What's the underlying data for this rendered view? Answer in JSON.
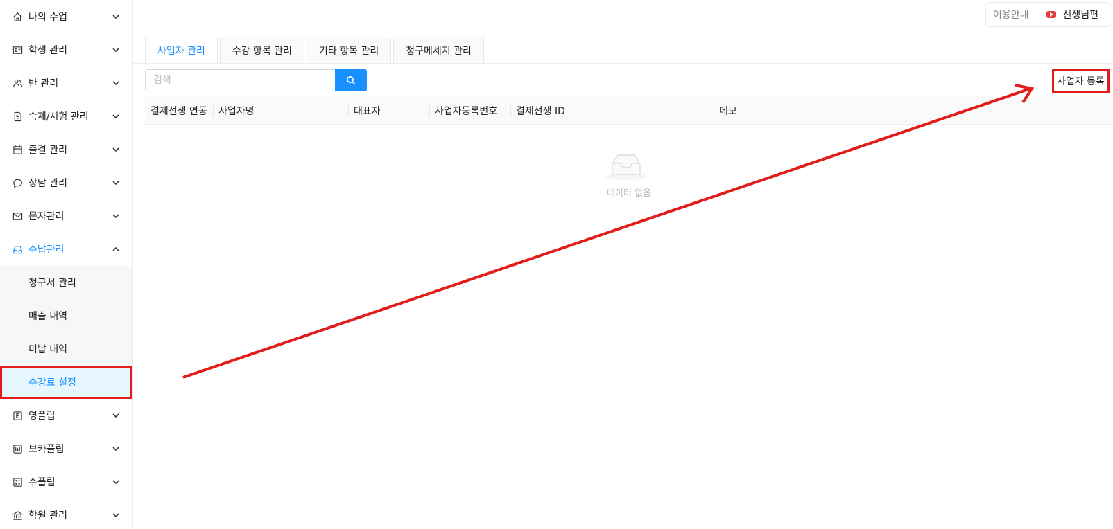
{
  "sidebar": {
    "items": [
      {
        "label": "나의 수업",
        "icon": "home-icon"
      },
      {
        "label": "학생 관리",
        "icon": "id-card-icon"
      },
      {
        "label": "반 관리",
        "icon": "users-icon"
      },
      {
        "label": "숙제/시험 관리",
        "icon": "document-icon"
      },
      {
        "label": "출결 관리",
        "icon": "calendar-icon"
      },
      {
        "label": "상담 관리",
        "icon": "chat-icon"
      },
      {
        "label": "문자관리",
        "icon": "mail-icon"
      },
      {
        "label": "수납관리",
        "icon": "inbox-icon"
      }
    ],
    "submenu": [
      {
        "label": "청구서 관리"
      },
      {
        "label": "매출 내역"
      },
      {
        "label": "미납 내역"
      },
      {
        "label": "수강료 설정"
      }
    ],
    "items_after": [
      {
        "label": "영플립",
        "icon": "letter-e-icon"
      },
      {
        "label": "보카플립",
        "icon": "letter-w-icon"
      },
      {
        "label": "수플립",
        "icon": "calculator-icon"
      },
      {
        "label": "학원 관리",
        "icon": "bank-icon"
      }
    ]
  },
  "header": {
    "help_label": "이용안내",
    "teacher_label": "선생님편"
  },
  "tabs": [
    {
      "label": "사업자 관리"
    },
    {
      "label": "수강 항목 관리"
    },
    {
      "label": "기타 항목 관리"
    },
    {
      "label": "청구메세지 관리"
    }
  ],
  "search": {
    "placeholder": "검색"
  },
  "toolbar": {
    "register_label": "사업자 등록"
  },
  "table": {
    "columns": [
      "결제선생 연동",
      "사업자명",
      "대표자",
      "사업자등록번호",
      "결제선생 ID",
      "메모"
    ],
    "empty_text": "데이터 없음"
  },
  "colors": {
    "accent": "#1890ff",
    "annotation": "#e21b1b"
  }
}
